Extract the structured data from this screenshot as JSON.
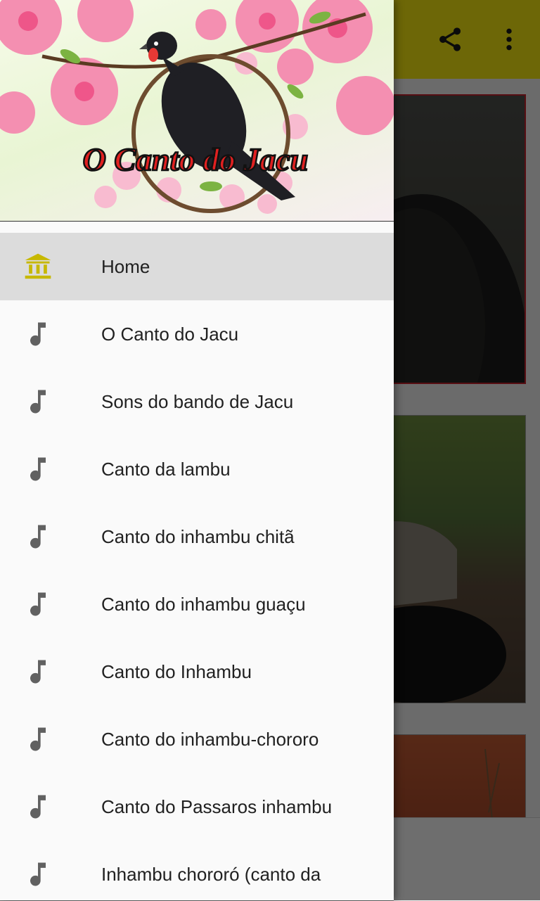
{
  "app": {
    "toolbar": {
      "share_icon": "share-icon",
      "more_icon": "more-vert-icon",
      "color": "#f2e511"
    }
  },
  "drawer": {
    "header_title": "O Canto do Jacu",
    "items": [
      {
        "label": "Home",
        "icon": "home-bank-icon",
        "active": true
      },
      {
        "label": "O Canto do Jacu",
        "icon": "music-note-icon"
      },
      {
        "label": "Sons do bando de Jacu",
        "icon": "music-note-icon"
      },
      {
        "label": "Canto da lambu",
        "icon": "music-note-icon"
      },
      {
        "label": "Canto do inhambu chitã",
        "icon": "music-note-icon"
      },
      {
        "label": "Canto do inhambu guaçu",
        "icon": "music-note-icon"
      },
      {
        "label": "Canto do Inhambu",
        "icon": "music-note-icon"
      },
      {
        "label": "Canto do inhambu-chororo",
        "icon": "music-note-icon"
      },
      {
        "label": "Canto do Passaros inhambu",
        "icon": "music-note-icon"
      },
      {
        "label": "Inhambu chororó  (canto da",
        "icon": "music-note-icon"
      }
    ]
  },
  "colors": {
    "accent": "#f2e511",
    "icon_active": "#c7b800",
    "icon_default": "#616161",
    "card_border": "#c2212a"
  }
}
